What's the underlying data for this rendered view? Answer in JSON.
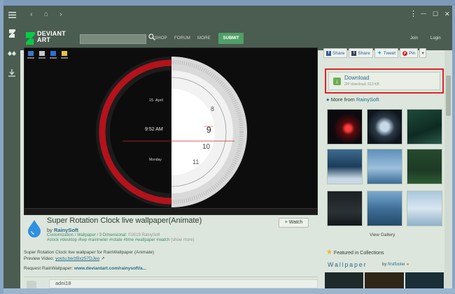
{
  "window": {
    "menu_icon": "hamburger-icon",
    "nav": {
      "back": "‹",
      "home": "⌂",
      "forward": "›"
    },
    "controls": {
      "more": "⋮",
      "minimize": "—",
      "maximize": "☐",
      "close": "✕"
    },
    "rail": [
      "deviantart-icon",
      "app-icon",
      "download-icon"
    ]
  },
  "site": {
    "logo_line1": "DEVIANT",
    "logo_line2": "ART",
    "search_placeholder": "",
    "nav": [
      "SHOP",
      "FORUM",
      "MORE"
    ],
    "submit": "SUBMIT",
    "join": "Join",
    "login": "Login",
    "accent": "#05cc47"
  },
  "preview": {
    "clock_date": "15. April",
    "clock_time": "9:52 AM",
    "clock_day": "Monday",
    "clock_numbers": [
      "8",
      "9",
      "10",
      "11"
    ]
  },
  "artwork": {
    "title": "Super Rotation Clock live wallpaper(Animate)",
    "by": "by",
    "author": "RainySoft",
    "categories": "Customization / Wallpaper / 3 Dimensional",
    "copyright": "©2019 RainySoft",
    "tags": "#clock #desktop #lwp #rainmeter #rotate #time #wallpaper #watch",
    "show_more": "(show more)",
    "watch": "Watch",
    "desc_line1": "Super Rotation Clock live wallpaper for RainWallpaper (Animate)",
    "preview_label": "Preview Video:",
    "preview_link": "youtu.be/zBxz57DJeo",
    "request_label": "Request RainWallpaper:",
    "request_link": "www.deviantart.com/rainysoft/a...",
    "comment_name": "adni18"
  },
  "sidebar": {
    "share": [
      "Share",
      "Share",
      "Tweet",
      "Pin"
    ],
    "download_label": "Download",
    "download_sub": "ZIP download, 613 KB",
    "more_from": "More from",
    "more_from_author": "RainySoft",
    "view_gallery": "View Gallery",
    "featured": "Featured in Collections",
    "collection_title": "Wallpaper",
    "collection_by": "by",
    "collection_author": "firstfooter",
    "highlight_color": "#e0232b"
  }
}
